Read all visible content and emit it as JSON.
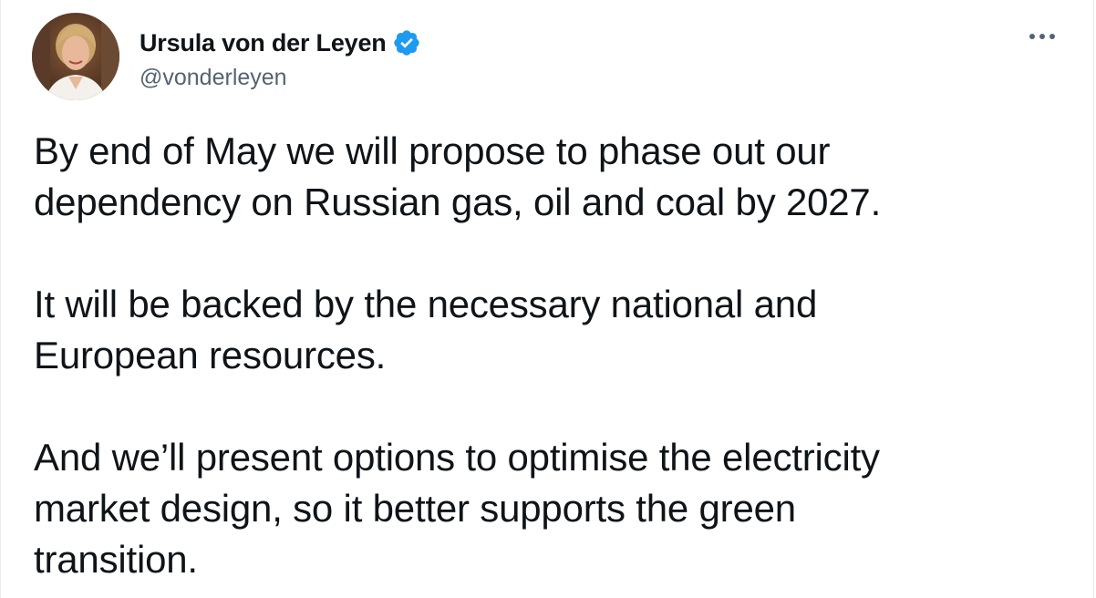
{
  "author": {
    "name": "Ursula von der Leyen",
    "handle": "@vonderleyen",
    "verified": true,
    "verified_color": "#1d9bf0"
  },
  "menu": {
    "icon": "more-horizontal-icon"
  },
  "tweet": {
    "paragraphs": [
      "By end of May we will propose to phase out our\ndependency on Russian gas, oil and coal by 2027.",
      "It will be backed by the necessary national and\nEuropean resources.",
      "And we’ll present options to optimise the electricity\nmarket design, so it better supports the green\ntransition."
    ]
  },
  "colors": {
    "text_primary": "#0f1419",
    "text_secondary": "#536471",
    "accent": "#1d9bf0"
  }
}
